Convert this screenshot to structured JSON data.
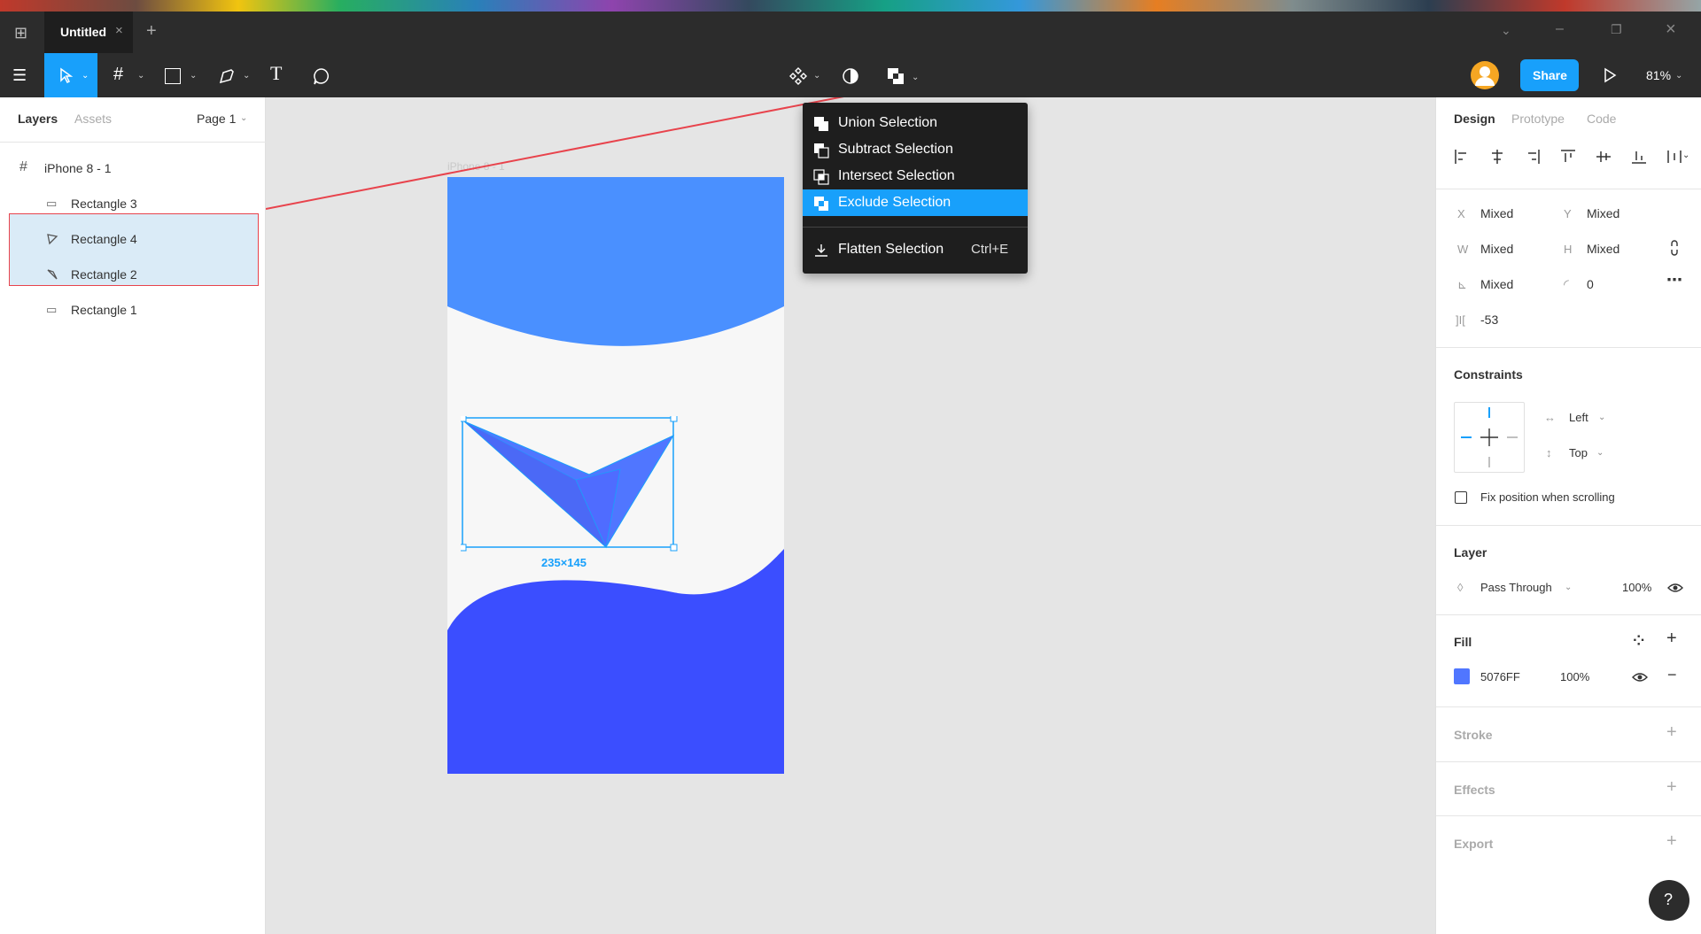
{
  "app": {
    "tab_title": "Untitled",
    "share_label": "Share",
    "zoom": "81%"
  },
  "left_panel": {
    "tabs": [
      "Layers",
      "Assets"
    ],
    "page_selector": "Page 1",
    "frame_name": "iPhone 8 - 1",
    "layers": [
      {
        "name": "Rectangle 3",
        "selected": false
      },
      {
        "name": "Rectangle 4",
        "selected": true
      },
      {
        "name": "Rectangle 2",
        "selected": true
      },
      {
        "name": "Rectangle 1",
        "selected": false
      }
    ]
  },
  "canvas": {
    "frame_label": "iPhone 8 - 1",
    "selection_size": "235×145",
    "colors": {
      "top_wave": "#4a90ff",
      "bottom_wave": "#3b4eff",
      "triangle": "#5076ff",
      "frame_bg": "#f7f7f7",
      "selection": "#18a0fb"
    }
  },
  "boolean_menu": {
    "items": [
      {
        "label": "Union Selection",
        "icon": "union-icon",
        "active": false
      },
      {
        "label": "Subtract Selection",
        "icon": "subtract-icon",
        "active": false
      },
      {
        "label": "Intersect Selection",
        "icon": "intersect-icon",
        "active": false
      },
      {
        "label": "Exclude Selection",
        "icon": "exclude-icon",
        "active": true
      }
    ],
    "flatten": {
      "label": "Flatten Selection",
      "shortcut": "Ctrl+E"
    }
  },
  "right_panel": {
    "tabs": [
      "Design",
      "Prototype",
      "Code"
    ],
    "x_label": "X",
    "x_value": "Mixed",
    "y_label": "Y",
    "y_value": "Mixed",
    "w_label": "W",
    "w_value": "Mixed",
    "h_label": "H",
    "h_value": "Mixed",
    "rotation_value": "Mixed",
    "radius_value": "0",
    "spacing_value": "-53",
    "constraints_title": "Constraints",
    "horizontal_constraint": "Left",
    "vertical_constraint": "Top",
    "fix_position_label": "Fix position when scrolling",
    "layer_title": "Layer",
    "blend_mode": "Pass Through",
    "layer_opacity": "100%",
    "fill_title": "Fill",
    "fill_hex": "5076FF",
    "fill_color": "#5076ff",
    "fill_opacity": "100%",
    "stroke_title": "Stroke",
    "effects_title": "Effects",
    "export_title": "Export",
    "help_label": "?"
  }
}
